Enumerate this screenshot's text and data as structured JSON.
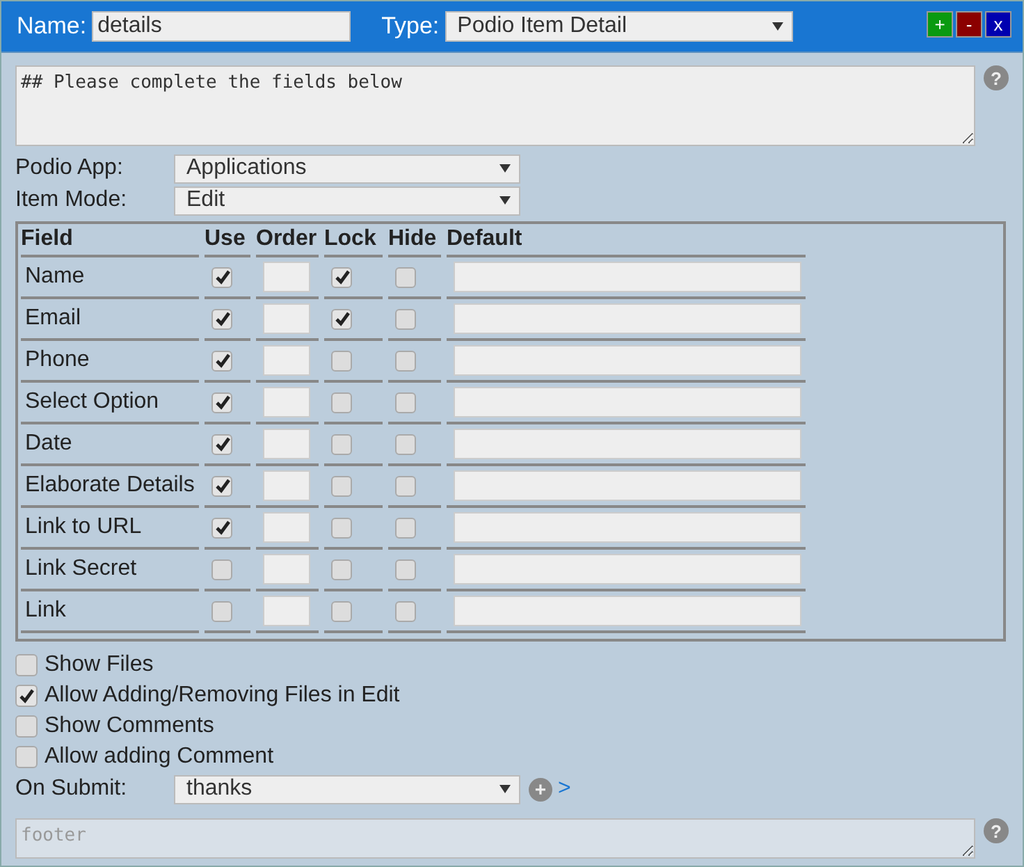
{
  "header": {
    "name_label": "Name:",
    "name_value": "details",
    "type_label": "Type:",
    "type_value": "Podio Item Detail",
    "buttons": [
      {
        "label": "+",
        "kind": "add"
      },
      {
        "label": "-",
        "kind": "remove"
      },
      {
        "label": "x",
        "kind": "close"
      }
    ]
  },
  "intro": {
    "value": "## Please complete the fields below",
    "help": "?"
  },
  "app": {
    "label": "Podio App:",
    "value": "Applications"
  },
  "mode": {
    "label": "Item Mode:",
    "value": "Edit"
  },
  "table": {
    "columns": [
      "Field",
      "Use",
      "Order",
      "Lock",
      "Hide",
      "Default"
    ],
    "rows": [
      {
        "field": "Name",
        "use": true,
        "lock": true,
        "hide": false
      },
      {
        "field": "Email",
        "use": true,
        "lock": true,
        "hide": false
      },
      {
        "field": "Phone",
        "use": true,
        "lock": false,
        "hide": false
      },
      {
        "field": "Select Option",
        "use": true,
        "lock": false,
        "hide": false
      },
      {
        "field": "Date",
        "use": true,
        "lock": false,
        "hide": false
      },
      {
        "field": "Elaborate Details",
        "use": true,
        "lock": false,
        "hide": false
      },
      {
        "field": "Link to URL",
        "use": true,
        "lock": false,
        "hide": false
      },
      {
        "field": "Link Secret",
        "use": false,
        "lock": false,
        "hide": false
      },
      {
        "field": "Link",
        "use": false,
        "lock": false,
        "hide": false
      }
    ]
  },
  "options": [
    {
      "label": "Show Files",
      "checked": false
    },
    {
      "label": "Allow Adding/Removing Files in Edit",
      "checked": true
    },
    {
      "label": "Show Comments",
      "checked": false
    },
    {
      "label": "Allow adding Comment",
      "checked": false
    }
  ],
  "submit": {
    "label": "On Submit:",
    "value": "thanks",
    "add": "+",
    "link": ">"
  },
  "footer": {
    "placeholder": "footer",
    "help": "?"
  }
}
